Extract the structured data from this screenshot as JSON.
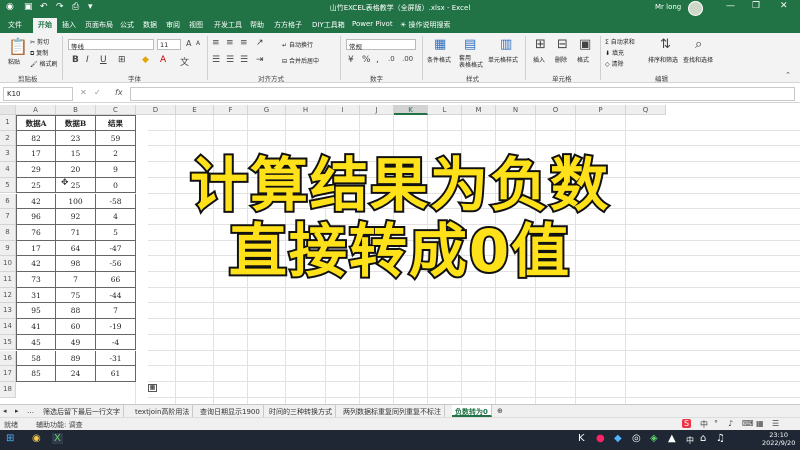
{
  "titlebar": {
    "title": "山竹EXCEL表格教学（全屏版）.xlsx - Excel",
    "user": "Mr long",
    "qa_icons": [
      "save-icon",
      "undo-icon",
      "redo-icon",
      "print-icon",
      "dropdown-icon"
    ],
    "min": "—",
    "max": "❐",
    "close": "✕"
  },
  "tabs": [
    "文件",
    "开始",
    "插入",
    "页面布局",
    "公式",
    "数据",
    "审阅",
    "视图",
    "开发工具",
    "帮助",
    "方方格子",
    "DIY工具箱",
    "Power Pivot"
  ],
  "tab_search": "操作说明搜索",
  "ribbon": {
    "clipboard": {
      "paste": "粘贴",
      "cut": "剪切",
      "copy": "复制",
      "painter": "格式刷",
      "group": "剪贴板"
    },
    "font": {
      "name": "等线",
      "size": "11",
      "group": "字体",
      "bold": "B",
      "italic": "I",
      "underline": "U",
      "grow": "A",
      "shrink": "A"
    },
    "align": {
      "wrap": "自动换行",
      "merge": "合并后居中",
      "group": "对齐方式"
    },
    "number": {
      "format": "常规",
      "group": "数字"
    },
    "styles": {
      "cond": "条件格式",
      "table": "套用\n表格格式",
      "cell": "单元格样式",
      "group": "样式"
    },
    "cells": {
      "insert": "插入",
      "delete": "删除",
      "format": "格式",
      "group": "单元格"
    },
    "edit": {
      "autosum": "自动求和",
      "fill": "填充",
      "clear": "清除",
      "sort": "排序和筛选",
      "find": "查找和选择",
      "group": "编辑"
    }
  },
  "formula": {
    "namebox": "K10",
    "fx": "fx",
    "value": ""
  },
  "columns": [
    "A",
    "B",
    "C",
    "D",
    "E",
    "F",
    "G",
    "H",
    "I",
    "J",
    "K",
    "L",
    "M",
    "N",
    "O",
    "P",
    "Q"
  ],
  "selected_column": "K",
  "rows": [
    "1",
    "2",
    "3",
    "4",
    "5",
    "6",
    "7",
    "8",
    "9",
    "10",
    "11",
    "12",
    "13",
    "14",
    "15",
    "16",
    "17",
    "18"
  ],
  "table": {
    "headers": [
      "数据A",
      "数据B",
      "结果"
    ],
    "data": [
      [
        "82",
        "23",
        "59"
      ],
      [
        "17",
        "15",
        "2"
      ],
      [
        "29",
        "20",
        "9"
      ],
      [
        "25",
        "25",
        "0"
      ],
      [
        "42",
        "100",
        "-58"
      ],
      [
        "96",
        "92",
        "4"
      ],
      [
        "76",
        "71",
        "5"
      ],
      [
        "17",
        "64",
        "-47"
      ],
      [
        "42",
        "98",
        "-56"
      ],
      [
        "73",
        "7",
        "66"
      ],
      [
        "31",
        "75",
        "-44"
      ],
      [
        "95",
        "88",
        "7"
      ],
      [
        "41",
        "60",
        "-19"
      ],
      [
        "45",
        "49",
        "-4"
      ],
      [
        "58",
        "89",
        "-31"
      ],
      [
        "85",
        "24",
        "61"
      ]
    ]
  },
  "overlay": {
    "line1": "计算结果为负数",
    "line2": "直接转成0值"
  },
  "sheet_tabs": [
    "筛选后留下最后一行文字",
    "textjoin高阶用法",
    "查询日期显示1900",
    "时间的三种转换方式",
    "两列数据标重复同列重复不标注",
    "负数转为0"
  ],
  "active_sheet": "负数转为0",
  "sheet_nav": [
    "◂",
    "▸",
    "…"
  ],
  "status": {
    "mode": "就绪",
    "accessibility": "辅助功能: 调查"
  },
  "clock": {
    "time": "23:10",
    "date": "2022/9/20"
  },
  "colors": {
    "excel_green": "#217346",
    "overlay_yellow": "#ffe11a"
  }
}
